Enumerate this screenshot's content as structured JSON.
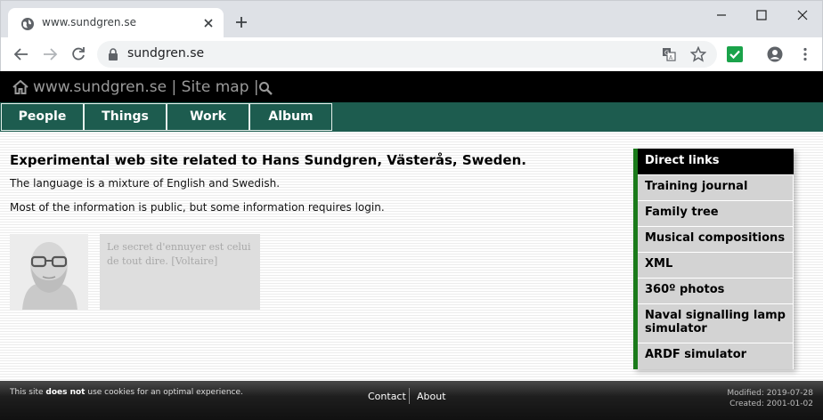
{
  "browser": {
    "tab_title": "www.sundgren.se",
    "url": "sundgren.se",
    "icons": [
      "globe-icon",
      "close-icon",
      "plus-icon",
      "minimize-icon",
      "maximize-icon",
      "window-close-icon",
      "back-arrow-icon",
      "forward-arrow-icon",
      "reload-icon",
      "lock-icon",
      "translate-icon",
      "star-icon",
      "extension-check-icon",
      "account-icon",
      "menu-kebab-icon"
    ],
    "extension_color": "#1aa34a"
  },
  "header": {
    "site_link": "www.sundgren.se",
    "separator1": "|",
    "sitemap_link": "Site map",
    "separator2": "|"
  },
  "nav": {
    "items": [
      {
        "label": "People"
      },
      {
        "label": "Things"
      },
      {
        "label": "Work"
      },
      {
        "label": "Album"
      }
    ],
    "color": "#1d5c4f"
  },
  "main": {
    "headline": "Experimental web site related to Hans Sundgren, Västerås, Sweden.",
    "para1": "The language is a mixture of English and Swedish.",
    "para2": "Most of the information is public, but some information requires login.",
    "quote": "Le secret d'ennuyer est celui de tout dire. [Voltaire]"
  },
  "sidebar": {
    "title": "Direct links",
    "links": [
      {
        "label": "Training journal"
      },
      {
        "label": "Family tree"
      },
      {
        "label": "Musical compositions"
      },
      {
        "label": "XML"
      },
      {
        "label": "360º photos"
      },
      {
        "label": "Naval signalling lamp simulator"
      },
      {
        "label": "ARDF simulator"
      }
    ],
    "accent": "#1a7a1a"
  },
  "footer": {
    "cookie_pre": "This site ",
    "cookie_bold": "does not",
    "cookie_post": " use cookies for an optimal experience.",
    "contact": "Contact",
    "about": "About",
    "modified": "Modified: 2019-07-28",
    "created": "Created: 2001-01-02"
  }
}
